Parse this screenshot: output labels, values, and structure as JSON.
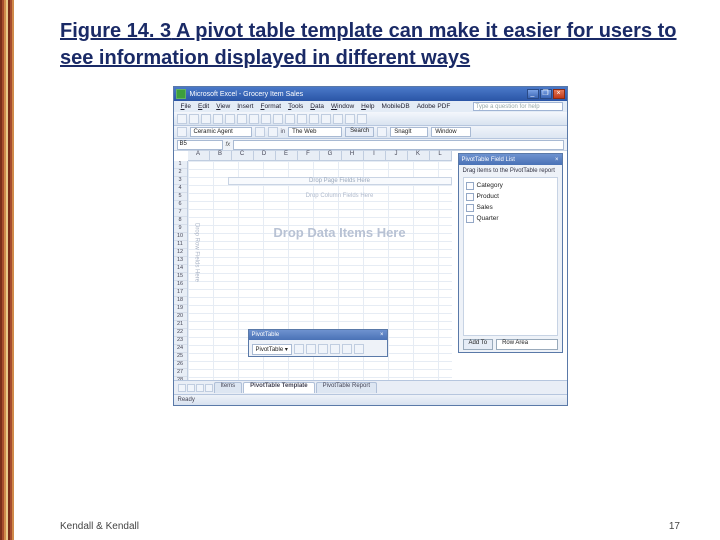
{
  "slide": {
    "figure_label": "Figure 14. 3",
    "figure_caption": "A pivot table template can make it easier for users to see information displayed in different ways",
    "footer_left": "Kendall & Kendall",
    "footer_right": "17"
  },
  "excel": {
    "titlebar": "Microsoft Excel - Grocery Item Sales",
    "window_buttons": {
      "min": "_",
      "max": "❐",
      "close": "×"
    },
    "menu": [
      "File",
      "Edit",
      "View",
      "Insert",
      "Format",
      "Tools",
      "Data",
      "Window",
      "Help",
      "MobileDB",
      "Adobe PDF"
    ],
    "help_placeholder": "Type a question for help",
    "toolbar2": {
      "agent_label": "Ceramic Agent",
      "web_label": "The Web",
      "search_btn": "Search",
      "snagit": "SnagIt",
      "window_opt": "Window"
    },
    "namebox": "B5",
    "fx": "fx",
    "columns": [
      "A",
      "B",
      "C",
      "D",
      "E",
      "F",
      "G",
      "H",
      "I",
      "J",
      "K",
      "L"
    ],
    "row_count": 28,
    "drop_page": "Drop Page Fields Here",
    "drop_col": "Drop Column Fields Here",
    "drop_row": "Drop Row Fields Here",
    "drop_data": "Drop Data Items Here",
    "pivot_toolbar": {
      "title": "PivotTable",
      "dropdown": "PivotTable ▾",
      "close": "×"
    },
    "field_list": {
      "title": "PivotTable Field List",
      "close": "×",
      "hint": "Drag items to the PivotTable report",
      "items": [
        "Category",
        "Product",
        "Sales",
        "Quarter"
      ],
      "add_btn": "Add To",
      "area_select": "Row Area"
    },
    "sheet_tabs": {
      "items": [
        "Items",
        "PivotTable Template",
        "PivotTable Report"
      ],
      "active_index": 1
    },
    "status": "Ready"
  }
}
